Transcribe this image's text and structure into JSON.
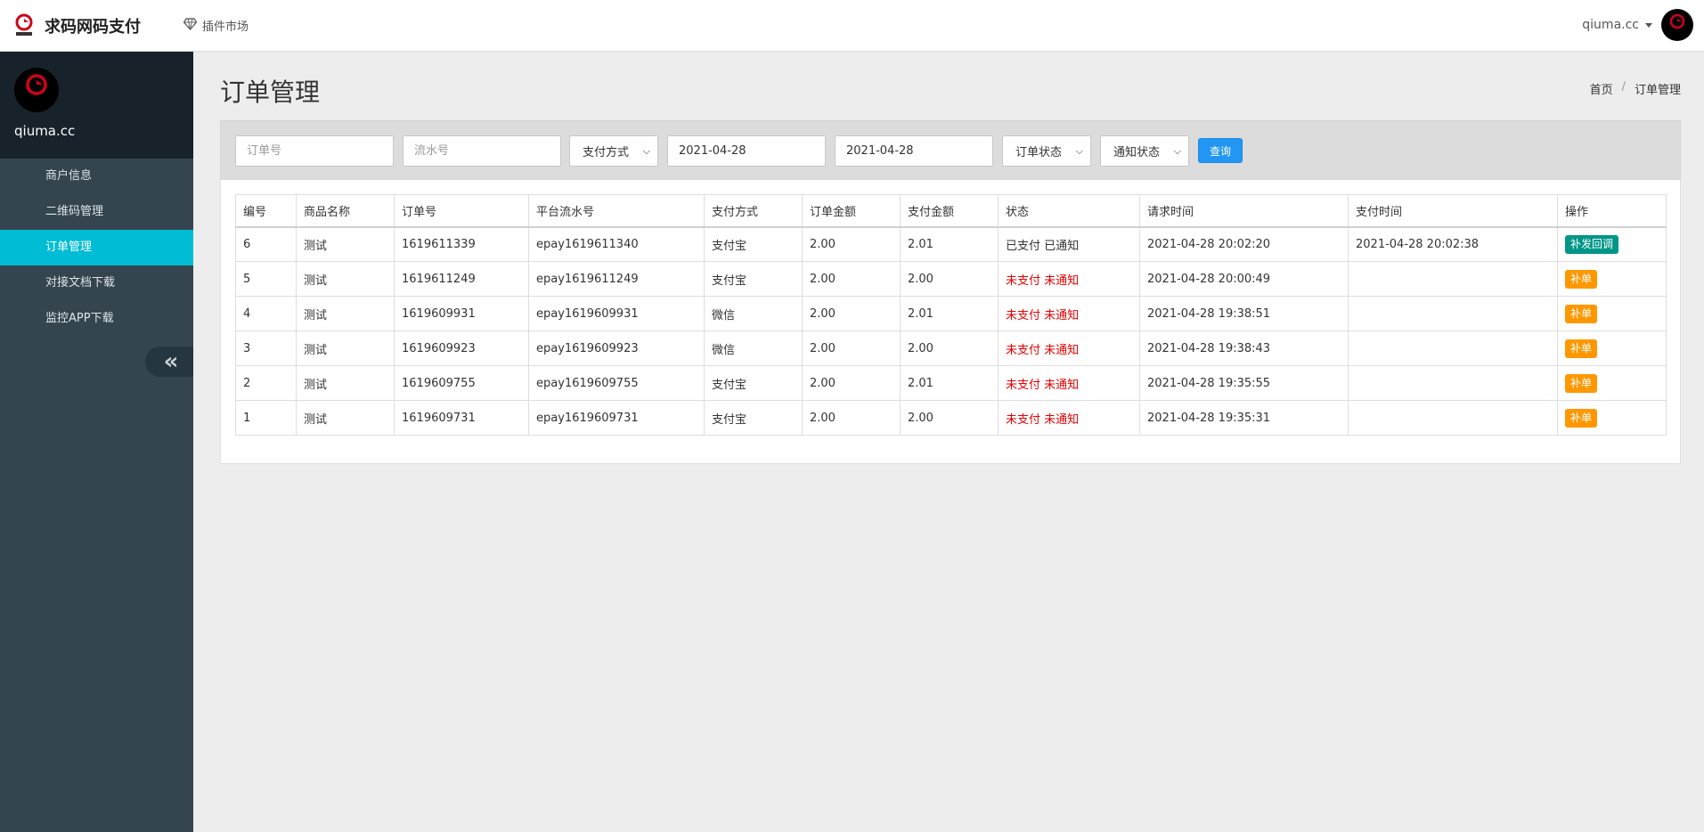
{
  "navbar": {
    "brand_name": "求码网码支付",
    "plugin_label": "插件市场",
    "user_name": "qiuma.cc"
  },
  "sidebar": {
    "user_name": "qiuma.cc",
    "items": [
      {
        "label": "商户信息",
        "active": false
      },
      {
        "label": "二维码管理",
        "active": false
      },
      {
        "label": "订单管理",
        "active": true
      },
      {
        "label": "对接文档下载",
        "active": false
      },
      {
        "label": "监控APP下载",
        "active": false
      }
    ],
    "collapse_glyph": "«"
  },
  "page": {
    "title": "订单管理",
    "breadcrumb": [
      "首页",
      "订单管理"
    ],
    "breadcrumb_sep": "/"
  },
  "filters": {
    "order_no_placeholder": "订单号",
    "serial_no_placeholder": "流水号",
    "pay_method": "支付方式",
    "start_date": "2021-04-28",
    "end_date": "2021-04-28",
    "order_status": "订单状态",
    "notify_status": "通知状态",
    "search_label": "查询"
  },
  "table": {
    "headers": [
      "编号",
      "商品名称",
      "订单号",
      "平台流水号",
      "支付方式",
      "订单金额",
      "支付金额",
      "状态",
      "请求时间",
      "支付时间",
      "操作"
    ],
    "rows": [
      {
        "id": "6",
        "product": "测试",
        "order_no": "1619611339",
        "serial": "epay1619611340",
        "method": "支付宝",
        "order_amount": "2.00",
        "pay_amount": "2.01",
        "status": "已支付 已通知",
        "paid": true,
        "request_time": "2021-04-28 20:02:20",
        "pay_time": "2021-04-28 20:02:38",
        "action": "补发回调"
      },
      {
        "id": "5",
        "product": "测试",
        "order_no": "1619611249",
        "serial": "epay1619611249",
        "method": "支付宝",
        "order_amount": "2.00",
        "pay_amount": "2.00",
        "status": "未支付 未通知",
        "paid": false,
        "request_time": "2021-04-28 20:00:49",
        "pay_time": "",
        "action": "补单"
      },
      {
        "id": "4",
        "product": "测试",
        "order_no": "1619609931",
        "serial": "epay1619609931",
        "method": "微信",
        "order_amount": "2.00",
        "pay_amount": "2.01",
        "status": "未支付 未通知",
        "paid": false,
        "request_time": "2021-04-28 19:38:51",
        "pay_time": "",
        "action": "补单"
      },
      {
        "id": "3",
        "product": "测试",
        "order_no": "1619609923",
        "serial": "epay1619609923",
        "method": "微信",
        "order_amount": "2.00",
        "pay_amount": "2.00",
        "status": "未支付 未通知",
        "paid": false,
        "request_time": "2021-04-28 19:38:43",
        "pay_time": "",
        "action": "补单"
      },
      {
        "id": "2",
        "product": "测试",
        "order_no": "1619609755",
        "serial": "epay1619609755",
        "method": "支付宝",
        "order_amount": "2.00",
        "pay_amount": "2.01",
        "status": "未支付 未通知",
        "paid": false,
        "request_time": "2021-04-28 19:35:55",
        "pay_time": "",
        "action": "补单"
      },
      {
        "id": "1",
        "product": "测试",
        "order_no": "1619609731",
        "serial": "epay1619609731",
        "method": "支付宝",
        "order_amount": "2.00",
        "pay_amount": "2.00",
        "status": "未支付 未通知",
        "paid": false,
        "request_time": "2021-04-28 19:35:31",
        "pay_time": "",
        "action": "补单"
      }
    ]
  },
  "colors": {
    "accent": "#00bcd4",
    "sidebar_bg": "#34454f",
    "primary_button": "#2196f3",
    "success_button": "#009688",
    "warning_button": "#ff9800",
    "unpaid_text": "#e60000"
  },
  "icons": {
    "brand": "brand-logo-icon",
    "plugin": "diamond-icon",
    "dropdown": "caret-down-icon",
    "collapse": "double-chevron-left-icon"
  }
}
